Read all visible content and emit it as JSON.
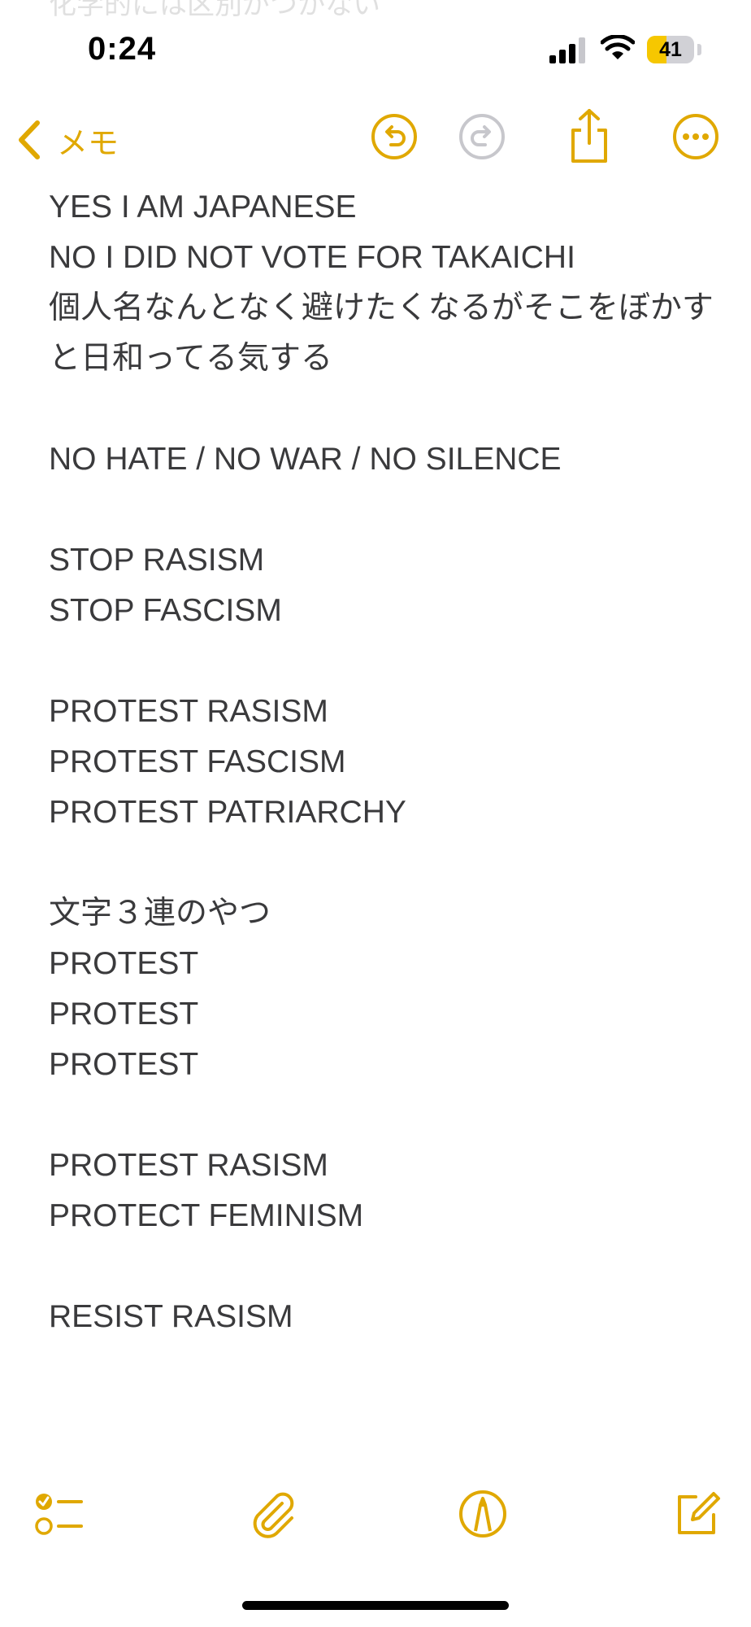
{
  "ghost_text": "化学的には区別がつかない",
  "status_bar": {
    "time": "0:24",
    "battery_level": "41",
    "battery_fraction": 0.41,
    "icons": [
      "cellular-signal-icon",
      "wifi-icon",
      "battery-icon"
    ]
  },
  "nav": {
    "back_label": "メモ",
    "icons": [
      "chevron-left-icon",
      "undo-icon",
      "redo-icon",
      "share-icon",
      "more-icon"
    ]
  },
  "colors": {
    "accent": "#e0a800",
    "text": "#3a3a3c",
    "disabled": "#c7c7cc",
    "battery_fill": "#f6c700"
  },
  "note": {
    "lines": [
      "YES I AM JAPANESE",
      "NO I DID NOT VOTE FOR TAKAICHI",
      "個人名なんとなく避けたくなるがそこをぼかすと日和ってる気する",
      "",
      "NO HATE / NO WAR / NO SILENCE",
      "",
      "STOP RASISM",
      "STOP FASCISM",
      "",
      "PROTEST RASISM",
      "PROTEST FASCISM",
      "PROTEST PATRIARCHY",
      "",
      "文字３連のやつ",
      "PROTEST",
      "PROTEST",
      "PROTEST",
      "",
      "PROTEST RASISM",
      "PROTECT FEMINISM",
      "",
      "RESIST RASISM"
    ]
  },
  "toolbar": {
    "icons": [
      "checklist-icon",
      "paperclip-icon",
      "markup-pen-icon",
      "compose-icon"
    ]
  }
}
